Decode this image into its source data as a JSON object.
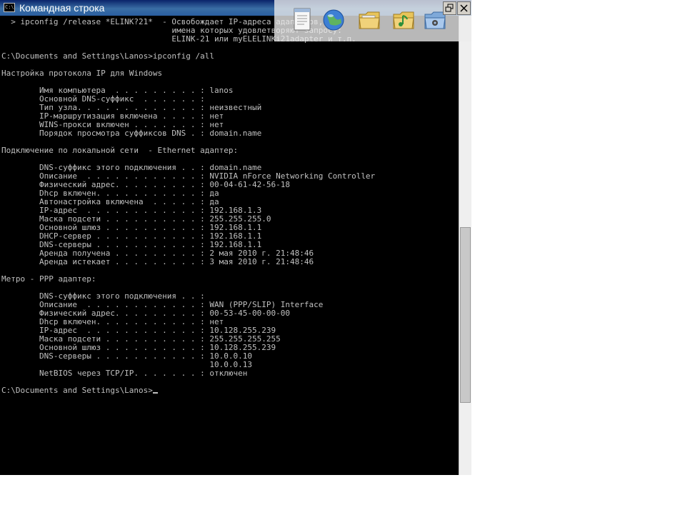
{
  "window": {
    "title": "Командная строка",
    "app_icon_text": "C:\\"
  },
  "console": {
    "lines": [
      "  > ipconfig /release *ELINK?21*  - Освобождает IP-адреса адаптеров,",
      "                                    имена которых удовлетворяют запросу:",
      "                                    ELINK-21 или myELELINKi21adapter и т.п.",
      "",
      "C:\\Documents and Settings\\Lanos>ipconfig /all",
      "",
      "Настройка протокола IP для Windows",
      "",
      "        Имя компьютера  . . . . . . . . . : lanos",
      "        Основной DNS-суффикс  . . . . . . :",
      "        Тип узла. . . . . . . . . . . . . : неизвестный",
      "        IP-маршрутизация включена . . . . : нет",
      "        WINS-прокси включен . . . . . . . : нет",
      "        Порядок просмотра суффиксов DNS . : domain.name",
      "",
      "Подключение по локальной сети  - Ethernet адаптер:",
      "",
      "        DNS-суффикс этого подключения . . : domain.name",
      "        Описание  . . . . . . . . . . . . : NVIDIA nForce Networking Controller",
      "        Физический адрес. . . . . . . . . : 00-04-61-42-56-18",
      "        Dhcp включен. . . . . . . . . . . : да",
      "        Автонастройка включена  . . . . . : да",
      "        IP-адрес  . . . . . . . . . . . . : 192.168.1.3",
      "        Маска подсети . . . . . . . . . . : 255.255.255.0",
      "        Основной шлюз . . . . . . . . . . : 192.168.1.1",
      "        DHCP-сервер . . . . . . . . . . . : 192.168.1.1",
      "        DNS-серверы . . . . . . . . . . . : 192.168.1.1",
      "        Аренда получена . . . . . . . . . : 2 мая 2010 г. 21:48:46",
      "        Аренда истекает . . . . . . . . . : 3 мая 2010 г. 21:48:46",
      "",
      "Метро - PPP адаптер:",
      "",
      "        DNS-суффикс этого подключения . . :",
      "        Описание  . . . . . . . . . . . . : WAN (PPP/SLIP) Interface",
      "        Физический адрес. . . . . . . . . : 00-53-45-00-00-00",
      "        Dhcp включен. . . . . . . . . . . : нет",
      "        IP-адрес  . . . . . . . . . . . . : 10.128.255.239",
      "        Маска подсети . . . . . . . . . . : 255.255.255.255",
      "        Основной шлюз . . . . . . . . . . : 10.128.255.239",
      "        DNS-серверы . . . . . . . . . . . : 10.0.0.10",
      "                                            10.0.0.13",
      "        NetBIOS через TCP/IP. . . . . . . : отключен",
      "",
      "C:\\Documents and Settings\\Lanos>"
    ]
  },
  "overlay_icons": [
    "notepad-icon",
    "globe-icon",
    "folder-icon",
    "music-folder-icon",
    "settings-folder-icon"
  ],
  "colors": {
    "console_bg": "#000000",
    "console_text": "#c0c0c0",
    "titlebar": "#0a246a"
  }
}
